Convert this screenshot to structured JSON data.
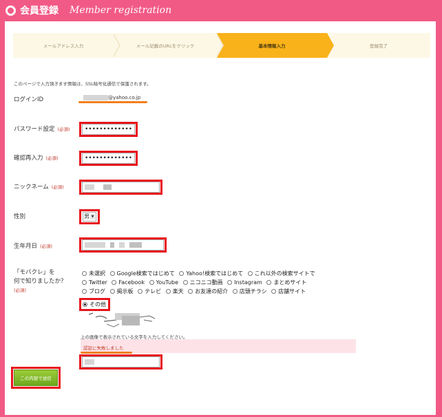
{
  "header": {
    "title_jp": "会員登録",
    "title_en": "Member registration"
  },
  "steps": [
    {
      "label": "メールアドレス入力",
      "active": false
    },
    {
      "label": "メール記載のURLをクリック",
      "active": false
    },
    {
      "label": "基本情報入力",
      "active": true
    },
    {
      "label": "登録完了",
      "active": false
    }
  ],
  "notice": "このページで入力頂きます情報は、SSL暗号化通信で保護されます。",
  "required_mark": "(必須)",
  "login": {
    "label": "ログインID",
    "value_suffix": "@yahoo.co.jp"
  },
  "password": {
    "label": "パスワード設定",
    "value": "•••••••••••••"
  },
  "password_confirm": {
    "label": "確認再入力",
    "value": "•••••••••••••"
  },
  "nickname": {
    "label": "ニックネーム"
  },
  "gender": {
    "label": "性別",
    "selected": "男"
  },
  "birthday": {
    "label": "生年月日"
  },
  "source": {
    "label_line1": "「モバクレ」を",
    "label_line2": "何で知りましたか？",
    "options": [
      "未選択",
      "Google検索ではじめて",
      "Yahoo!検索ではじめて",
      "これ以外の検索サイトで",
      "Twitter",
      "Facebook",
      "YouTube",
      "ニコニコ動画",
      "Instagram",
      "まとめサイト",
      "ブログ",
      "掲示板",
      "テレビ",
      "楽天",
      "お友達の紹介",
      "店頭チラシ",
      "店舗サイト",
      "その他"
    ],
    "selected": "その他"
  },
  "captcha": {
    "note": "上の画像で表示されている文字を入力してください。",
    "error": "認証に失敗しました"
  },
  "submit_label": "この内容で送信",
  "colors": {
    "brand_pink": "#f25a86",
    "step_active": "#f9b21a",
    "highlight_red": "#e8141c",
    "underline_orange": "#f07f1d",
    "submit_green": "#7fb526"
  }
}
